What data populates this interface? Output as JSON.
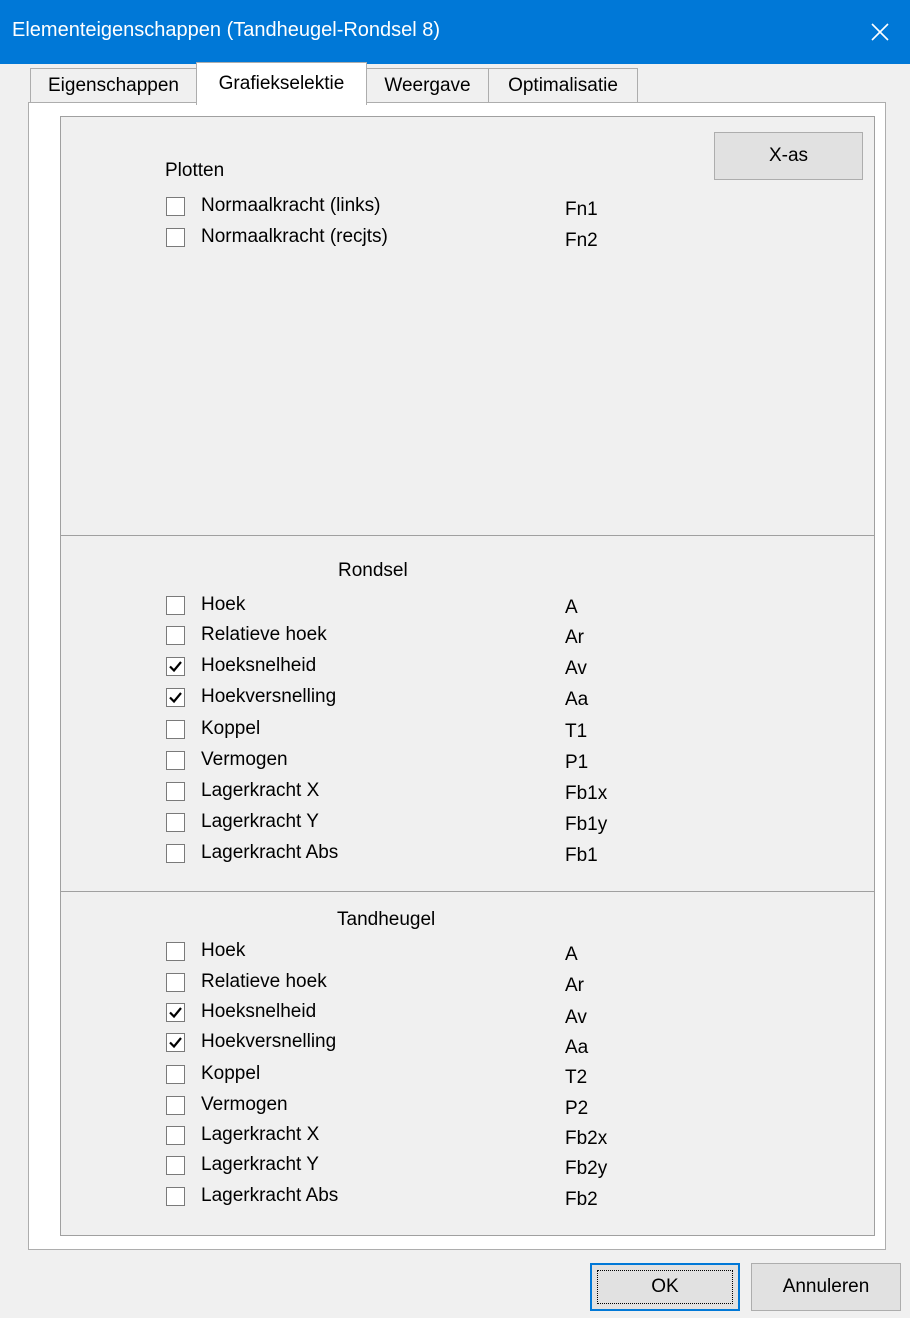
{
  "window": {
    "title": "Elementeigenschappen (Tandheugel-Rondsel 8)"
  },
  "tabs": [
    {
      "label": "Eigenschappen",
      "active": false
    },
    {
      "label": "Grafiekselektie",
      "active": true
    },
    {
      "label": "Weergave",
      "active": false
    },
    {
      "label": "Optimalisatie",
      "active": false
    }
  ],
  "plotten": {
    "title": "Plotten",
    "xas_button": "X-as",
    "items": [
      {
        "label": "Normaalkracht (links)",
        "code": "Fn1",
        "checked": false
      },
      {
        "label": "Normaalkracht (recjts)",
        "code": "Fn2",
        "checked": false
      }
    ]
  },
  "rondsel": {
    "title": "Rondsel",
    "items": [
      {
        "label": "Hoek",
        "code": "A",
        "checked": false
      },
      {
        "label": "Relatieve hoek",
        "code": "Ar",
        "checked": false
      },
      {
        "label": "Hoeksnelheid",
        "code": "Av",
        "checked": true
      },
      {
        "label": "Hoekversnelling",
        "code": "Aa",
        "checked": true
      },
      {
        "label": "Koppel",
        "code": "T1",
        "checked": false
      },
      {
        "label": "Vermogen",
        "code": "P1",
        "checked": false
      },
      {
        "label": "Lagerkracht X",
        "code": "Fb1x",
        "checked": false
      },
      {
        "label": "Lagerkracht Y",
        "code": "Fb1y",
        "checked": false
      },
      {
        "label": "Lagerkracht Abs",
        "code": "Fb1",
        "checked": false
      }
    ]
  },
  "tandheugel": {
    "title": "Tandheugel",
    "items": [
      {
        "label": "Hoek",
        "code": "A",
        "checked": false
      },
      {
        "label": "Relatieve hoek",
        "code": "Ar",
        "checked": false
      },
      {
        "label": "Hoeksnelheid",
        "code": "Av",
        "checked": true
      },
      {
        "label": "Hoekversnelling",
        "code": "Aa",
        "checked": true
      },
      {
        "label": "Koppel",
        "code": "T2",
        "checked": false
      },
      {
        "label": "Vermogen",
        "code": "P2",
        "checked": false
      },
      {
        "label": "Lagerkracht X",
        "code": "Fb2x",
        "checked": false
      },
      {
        "label": "Lagerkracht Y",
        "code": "Fb2y",
        "checked": false
      },
      {
        "label": "Lagerkracht Abs",
        "code": "Fb2",
        "checked": false
      }
    ]
  },
  "footer": {
    "ok": "OK",
    "cancel": "Annuleren"
  },
  "colors": {
    "titlebar": "#0078d7",
    "accent": "#0078d7"
  }
}
